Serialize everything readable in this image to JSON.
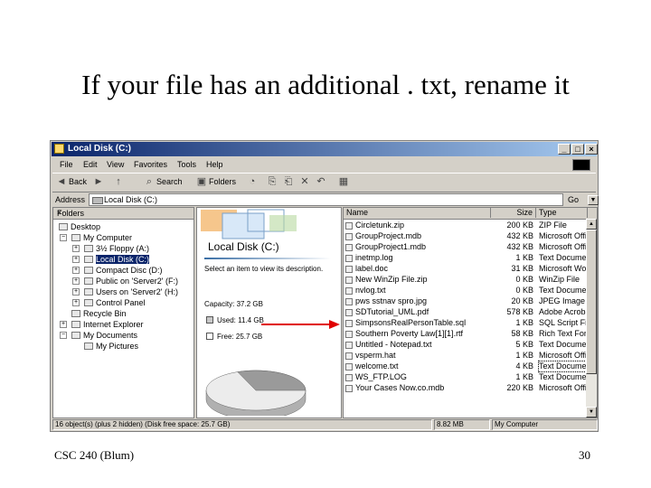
{
  "slide": {
    "title": "If your file has an additional . txt, rename it",
    "footer_left": "CSC 240 (Blum)",
    "page_number": "30"
  },
  "window": {
    "title": "Local Disk (C:)",
    "controls": {
      "minimize": "_",
      "maximize": "□",
      "close": "×"
    },
    "menu": [
      "File",
      "Edit",
      "View",
      "Favorites",
      "Tools",
      "Help"
    ],
    "toolbar": {
      "back": "Back",
      "search": "Search",
      "folders": "Folders"
    },
    "address": {
      "label": "Address",
      "value": "Local Disk (C:)",
      "go": "Go"
    },
    "folders_pane": {
      "title": "Folders",
      "close": "×",
      "items": [
        {
          "label": "Desktop"
        },
        {
          "label": "My Computer"
        },
        {
          "label": "3½ Floppy (A:)"
        },
        {
          "label": "Local Disk (C:)"
        },
        {
          "label": "Compact Disc (D:)"
        },
        {
          "label": "Public on 'Server2' (F:)"
        },
        {
          "label": "Users on 'Server2' (H:)"
        },
        {
          "label": "Control Panel"
        },
        {
          "label": "Recycle Bin"
        },
        {
          "label": "Internet Explorer"
        },
        {
          "label": "My Documents"
        },
        {
          "label": "My Pictures"
        }
      ]
    },
    "web_view": {
      "drive_title": "Local Disk (C:)",
      "description": "Select an item to view its description.",
      "capacity": "Capacity: 37.2 GB",
      "used": "Used: 11.4 GB",
      "free": "Free: 25.7 GB",
      "used_fraction": 0.31
    },
    "file_list": {
      "columns": {
        "name": "Name",
        "size": "Size",
        "type": "Type"
      },
      "rows": [
        {
          "name": "Circletunk.zip",
          "size": "200 KB",
          "type": "ZIP File"
        },
        {
          "name": "GroupProject.mdb",
          "size": "432 KB",
          "type": "Microsoft Office"
        },
        {
          "name": "GroupProject1.mdb",
          "size": "432 KB",
          "type": "Microsoft Office"
        },
        {
          "name": "inetmp.log",
          "size": "1 KB",
          "type": "Text Document"
        },
        {
          "name": "label.doc",
          "size": "31 KB",
          "type": "Microsoft Word"
        },
        {
          "name": "New WinZip File.zip",
          "size": "0 KB",
          "type": "WinZip File"
        },
        {
          "name": "nvlog.txt",
          "size": "0 KB",
          "type": "Text Document"
        },
        {
          "name": "pws sstnav spro.jpg",
          "size": "20 KB",
          "type": "JPEG Image"
        },
        {
          "name": "SDTutorial_UML.pdf",
          "size": "578 KB",
          "type": "Adobe Acrobat"
        },
        {
          "name": "SimpsonsRealPersonTable.sql",
          "size": "1 KB",
          "type": "SQL Script File"
        },
        {
          "name": "Southern Poverty Law[1][1].rtf",
          "size": "58 KB",
          "type": "Rich Text Format"
        },
        {
          "name": "Untitled - Notepad.txt",
          "size": "5 KB",
          "type": "Text Document"
        },
        {
          "name": "vsperm.hat",
          "size": "1 KB",
          "type": "Microsoft Office"
        },
        {
          "name": "welcome.txt",
          "size": "4 KB",
          "type": "Text Document"
        },
        {
          "name": "WS_FTP.LOG",
          "size": "1 KB",
          "type": "Text Document"
        },
        {
          "name": "Your Cases Now.co.mdb",
          "size": "220 KB",
          "type": "Microsoft Office"
        }
      ],
      "highlighted_row": 13
    },
    "status": {
      "left": "16 object(s) (plus 2 hidden) (Disk free space: 25.7 GB)",
      "middle": "8.82 MB",
      "right": "My Computer"
    }
  },
  "annotation": {
    "arrow_color": "#e00000"
  }
}
